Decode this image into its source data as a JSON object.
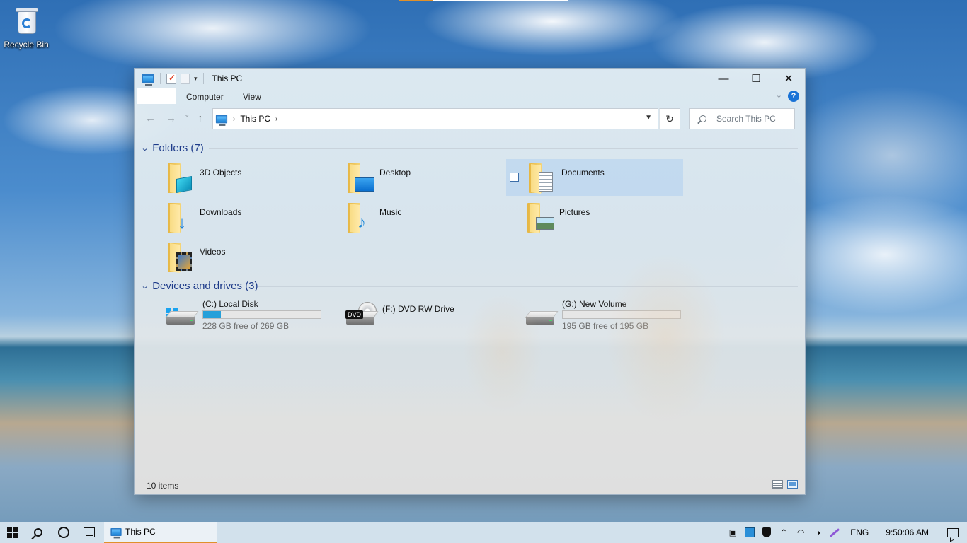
{
  "desktop": {
    "icons": [
      {
        "label": "Recycle Bin",
        "icon": "recycle-bin-icon"
      }
    ]
  },
  "window": {
    "title": "This PC",
    "qat_icons": [
      "this-pc-icon",
      "properties-icon",
      "new-folder-icon",
      "customize-qat-icon"
    ],
    "caption": {
      "minimize": "—",
      "maximize": "☐",
      "close": "✕"
    },
    "ribbon_tabs": [
      "Computer",
      "View"
    ],
    "help": "?",
    "nav": {
      "back": "←",
      "forward": "→",
      "recent": "⌄",
      "up": "↑"
    },
    "address": {
      "crumbs": [
        "This PC"
      ],
      "sep": "›"
    },
    "refresh": "↻",
    "search_placeholder": "Search This PC",
    "folders_header": "Folders (7)",
    "folders": [
      {
        "label": "3D Objects",
        "icon": "3d-objects-folder-icon"
      },
      {
        "label": "Desktop",
        "icon": "desktop-folder-icon"
      },
      {
        "label": "Documents",
        "icon": "documents-folder-icon",
        "selected": true
      },
      {
        "label": "Downloads",
        "icon": "downloads-folder-icon"
      },
      {
        "label": "Music",
        "icon": "music-folder-icon"
      },
      {
        "label": "Pictures",
        "icon": "pictures-folder-icon"
      },
      {
        "label": "Videos",
        "icon": "videos-folder-icon"
      }
    ],
    "drives_header": "Devices and drives (3)",
    "drives": [
      {
        "label": "(C:) Local Disk",
        "free_text": "228 GB free of 269 GB",
        "used_fraction": 0.152,
        "icon": "system-drive-icon"
      },
      {
        "label": "(F:) DVD RW Drive",
        "icon": "dvd-drive-icon",
        "dvd_badge": "DVD"
      },
      {
        "label": "(G:) New Volume",
        "free_text": "195 GB free of 195 GB",
        "used_fraction": 0.0,
        "icon": "hard-drive-icon"
      }
    ],
    "status": "10 items",
    "accent": "#26a0da"
  },
  "taskbar": {
    "app_label": "This PC",
    "tray": {
      "lang": "ENG",
      "time": "9:50:06 AM"
    }
  }
}
